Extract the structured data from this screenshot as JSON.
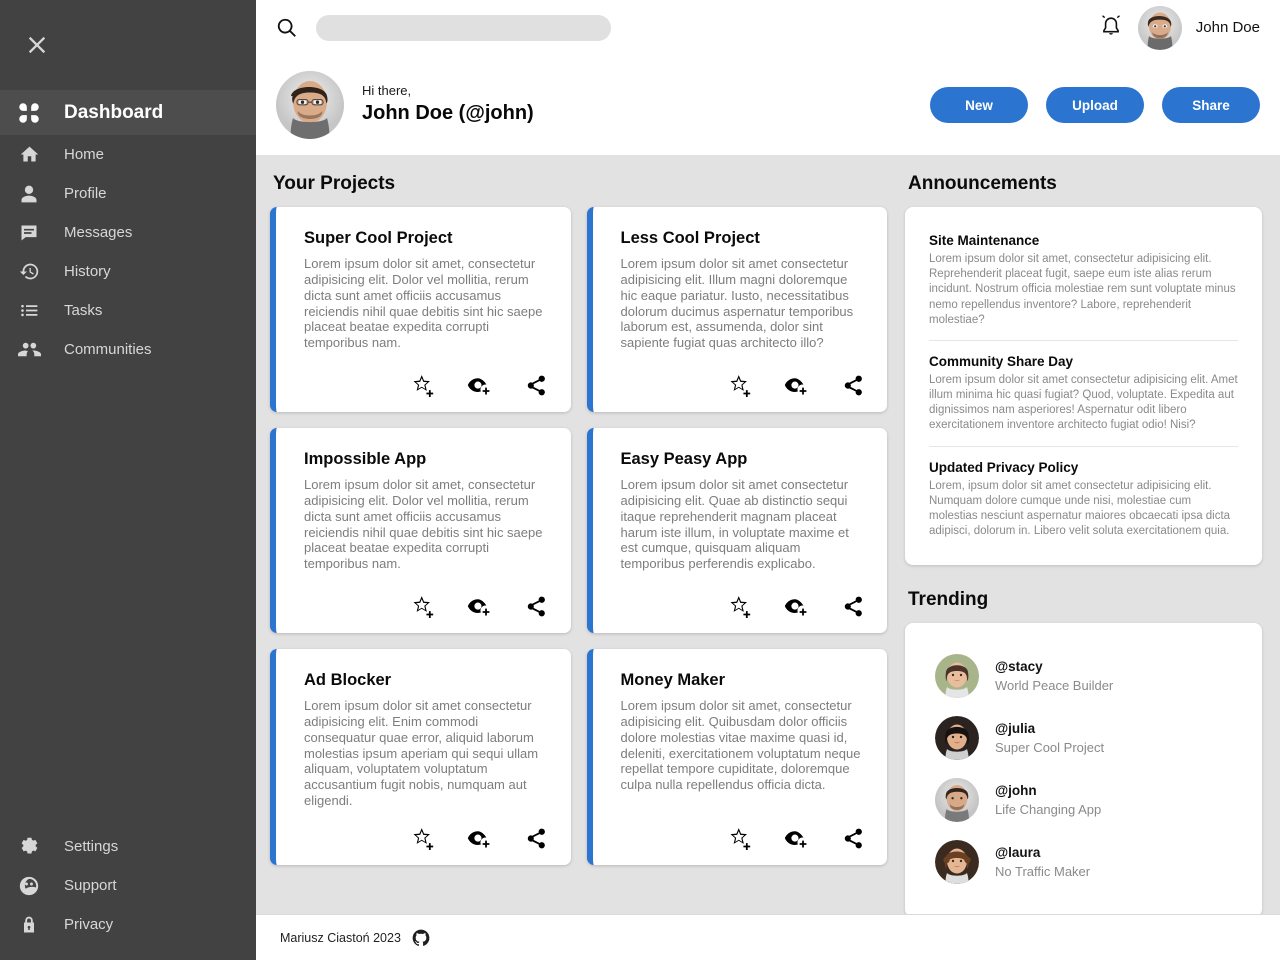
{
  "sidebar": {
    "close_icon": "close-icon",
    "nav_top": [
      {
        "label": "Dashboard",
        "icon": "dashboard-icon",
        "active": true
      },
      {
        "label": "Home",
        "icon": "home-icon",
        "active": false
      },
      {
        "label": "Profile",
        "icon": "person-icon",
        "active": false
      },
      {
        "label": "Messages",
        "icon": "chat-icon",
        "active": false
      },
      {
        "label": "History",
        "icon": "history-icon",
        "active": false
      },
      {
        "label": "Tasks",
        "icon": "list-icon",
        "active": false
      },
      {
        "label": "Communities",
        "icon": "people-icon",
        "active": false
      }
    ],
    "nav_bottom": [
      {
        "label": "Settings",
        "icon": "gear-icon"
      },
      {
        "label": "Support",
        "icon": "support-face-icon"
      },
      {
        "label": "Privacy",
        "icon": "lock-icon"
      }
    ]
  },
  "topbar": {
    "search_placeholder": "",
    "search_value": "",
    "search_icon": "search-icon",
    "bell_icon": "notification-bell-icon",
    "user_name": "John Doe",
    "avatar": "avatar"
  },
  "greeting": {
    "hi": "Hi there,",
    "name": "John Doe (@john)",
    "buttons": [
      {
        "label": "New"
      },
      {
        "label": "Upload"
      },
      {
        "label": "Share"
      }
    ]
  },
  "projects": {
    "title": "Your Projects",
    "actions": [
      "star-add-icon",
      "eye-add-icon",
      "share-icon"
    ],
    "items": [
      {
        "title": "Super Cool Project",
        "desc": "Lorem ipsum dolor sit amet, consectetur adipisicing elit. Dolor vel mollitia, rerum dicta sunt amet officiis accusamus reiciendis nihil quae debitis sint hic saepe placeat beatae expedita corrupti temporibus nam."
      },
      {
        "title": "Less Cool Project",
        "desc": "Lorem ipsum dolor sit amet consectetur adipisicing elit. Illum magni doloremque hic eaque pariatur. Iusto, necessitatibus dolorum ducimus aspernatur temporibus laborum est, assumenda, dolor sint sapiente fugiat quas architecto illo?"
      },
      {
        "title": "Impossible App",
        "desc": "Lorem ipsum dolor sit amet, consectetur adipisicing elit. Dolor vel mollitia, rerum dicta sunt amet officiis accusamus reiciendis nihil quae debitis sint hic saepe placeat beatae expedita corrupti temporibus nam."
      },
      {
        "title": "Easy Peasy App",
        "desc": "Lorem ipsum dolor sit amet consectetur adipisicing elit. Quae ab distinctio sequi itaque reprehenderit magnam placeat harum iste illum, in voluptate maxime et est cumque, quisquam aliquam temporibus perferendis explicabo."
      },
      {
        "title": "Ad Blocker",
        "desc": "Lorem ipsum dolor sit amet consectetur adipisicing elit. Enim commodi consequatur quae error, aliquid laborum molestias ipsum aperiam qui sequi ullam aliquam, voluptatem voluptatum accusantium fugit nobis, numquam aut eligendi."
      },
      {
        "title": "Money Maker",
        "desc": "Lorem ipsum dolor sit amet, consectetur adipisicing elit. Quibusdam dolor officiis dolore molestias vitae maxime quasi id, deleniti, exercitationem voluptatum neque repellat tempore cupiditate, doloremque culpa nulla repellendus officia dicta."
      }
    ]
  },
  "announcements": {
    "title": "Announcements",
    "items": [
      {
        "title": "Site Maintenance",
        "body": "Lorem ipsum dolor sit amet, consectetur adipisicing elit. Reprehenderit placeat fugit, saepe eum iste alias rerum incidunt. Nostrum officia molestiae rem sunt voluptate minus nemo repellendus inventore? Labore, reprehenderit molestiae?"
      },
      {
        "title": "Community Share Day",
        "body": "Lorem ipsum dolor sit amet consectetur adipisicing elit. Amet illum minima hic quasi fugiat? Quod, voluptate. Expedita aut dignissimos nam asperiores! Aspernatur odit libero exercitationem inventore architecto fugiat odio! Nisi?"
      },
      {
        "title": "Updated Privacy Policy",
        "body": "Lorem, ipsum dolor sit amet consectetur adipisicing elit. Numquam dolore cumque unde nisi, molestiae cum molestias nesciunt aspernatur maiores obcaecati ipsa dicta adipisci, dolorum in. Libero velit soluta exercitationem quia."
      }
    ]
  },
  "trending": {
    "title": "Trending",
    "items": [
      {
        "handle": "@stacy",
        "sub": "World Peace Builder"
      },
      {
        "handle": "@julia",
        "sub": "Super Cool Project"
      },
      {
        "handle": "@john",
        "sub": "Life Changing App"
      },
      {
        "handle": "@laura",
        "sub": "No Traffic Maker"
      }
    ]
  },
  "footer": {
    "text": "Mariusz Ciastoń 2023",
    "icon": "github-icon"
  },
  "colors": {
    "accent_blue": "#2b75d0",
    "sidebar_bg": "#424242",
    "sidebar_active_bg": "#4d4d4d",
    "content_bg": "#e2e2e2",
    "muted_text": "#8a8a8a"
  }
}
